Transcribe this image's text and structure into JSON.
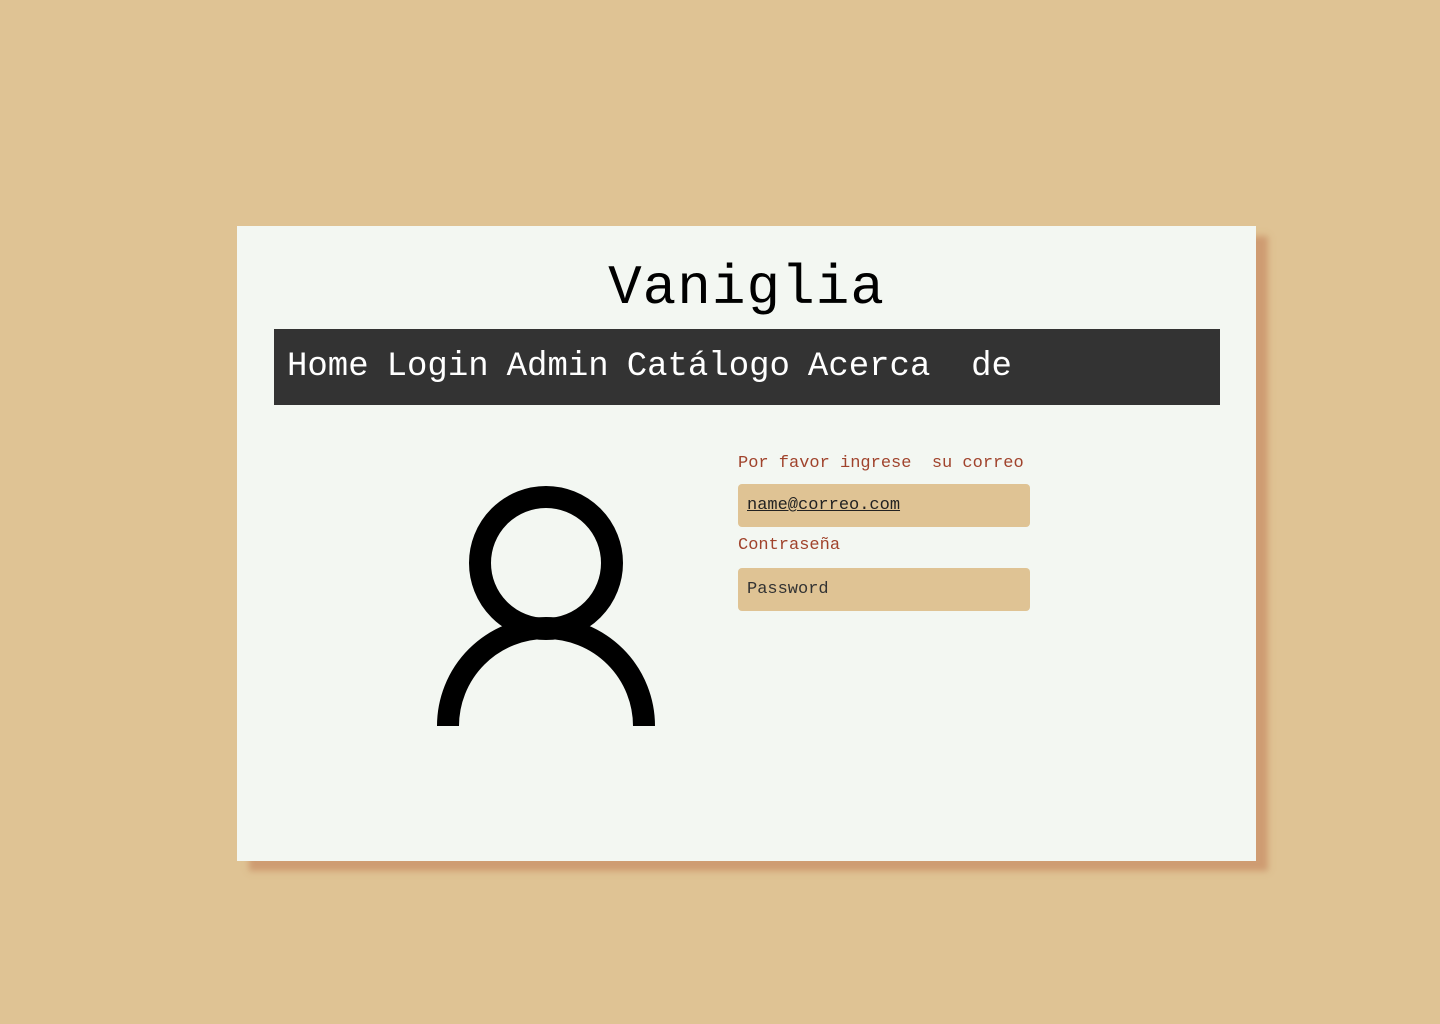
{
  "site": {
    "title": "Vaniglia"
  },
  "nav": {
    "items": [
      {
        "label": "Home"
      },
      {
        "label": "Login"
      },
      {
        "label": "Admin"
      },
      {
        "label": "Catálogo"
      },
      {
        "label": "Acerca  de"
      }
    ]
  },
  "avatar": {
    "icon": "user-icon"
  },
  "login_form": {
    "email_label": "Por favor ingrese  su correo",
    "email_value": "name@correo.com",
    "password_label": "Contraseña",
    "password_placeholder": "Password"
  },
  "colors": {
    "page_background": "#dfc394",
    "card_background": "#f3f7f2",
    "card_shadow": "#c89064",
    "navbar_background": "#333333",
    "label_text": "#a0432c",
    "input_background": "#dfc394"
  }
}
